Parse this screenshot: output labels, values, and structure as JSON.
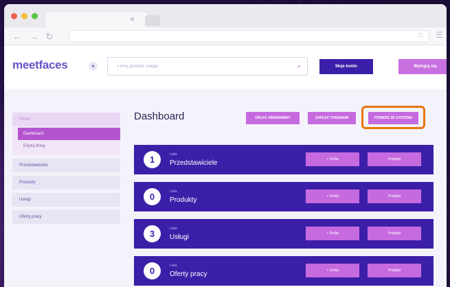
{
  "brand": {
    "name": "meetfaces",
    "accent": "#3c1fa8",
    "secondary": "#c66adf",
    "highlight": "#e8760f"
  },
  "header": {
    "lang_icon": "chevron-down-icon",
    "search_placeholder": "Firmy, produkt, usługa",
    "account_label": "Moje konto",
    "logout_label": "Wyloguj się"
  },
  "sidebar": {
    "group_title": "Firma",
    "sub_items": [
      {
        "label": "Dashboard",
        "active": true
      },
      {
        "label": "Edytuj firmę",
        "active": false
      }
    ],
    "items": [
      "Przedstawiciele",
      "Produkty",
      "Usługi",
      "Oferty pracy"
    ]
  },
  "main": {
    "title": "Dashboard",
    "actions": [
      "OPŁAĆ ABONAMENT",
      "ZAPŁAĆ TOKENAMI",
      "POBIERZ ZE SYSTEMU"
    ],
    "cards": [
      {
        "count": "1",
        "small": "Lista",
        "label": "Przedstawiciele",
        "add": "+ Dodaj",
        "view": "Podgląd"
      },
      {
        "count": "0",
        "small": "Lista",
        "label": "Produkty",
        "add": "+ Dodaj",
        "view": "Podgląd"
      },
      {
        "count": "3",
        "small": "Lista",
        "label": "Usługi",
        "add": "+ Dodaj",
        "view": "Podgląd"
      },
      {
        "count": "0",
        "small": "Lista",
        "label": "Oferty pracy",
        "add": "+ Dodaj",
        "view": "Podgląd"
      }
    ]
  }
}
